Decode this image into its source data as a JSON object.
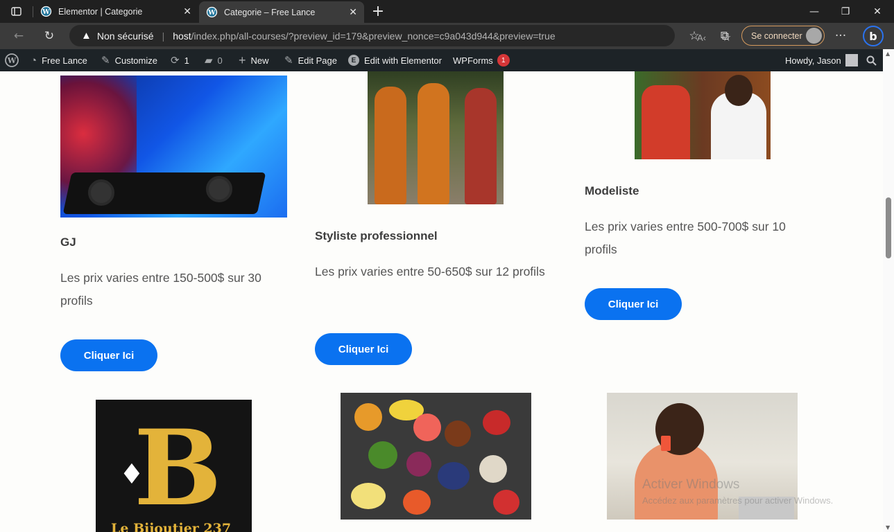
{
  "browser": {
    "tabs": [
      {
        "title": "Elementor | Categorie",
        "active": false
      },
      {
        "title": "Categorie – Free Lance",
        "active": true
      }
    ],
    "new_tab": "+",
    "address": {
      "security_label": "Non sécurisé",
      "host": "host",
      "path": "/index.php/all-courses/?preview_id=179&preview_nonce=c9a043d944&preview=true"
    },
    "sign_in_label": "Se connecter"
  },
  "wp_admin_bar": {
    "site_name": "Free Lance",
    "customize": "Customize",
    "updates_count": "1",
    "comments_count": "0",
    "new": "New",
    "edit_page": "Edit Page",
    "edit_elementor": "Edit with Elementor",
    "wpforms": "WPForms",
    "wpforms_badge": "1",
    "howdy": "Howdy, Jason"
  },
  "cards": [
    {
      "title": "GJ",
      "description": "Les prix varies entre 150-500$ sur 30 profils",
      "button": "Cliquer Ici"
    },
    {
      "title": "Styliste professionnel",
      "description": "Les prix varies entre 50-650$ sur 12 profils",
      "button": "Cliquer Ici"
    },
    {
      "title": "Modeliste",
      "description": "Les prix varies entre 500-700$ sur 10 profils",
      "button": "Cliquer Ici"
    }
  ],
  "bottom_images": {
    "bijou_text": "Le Bijoutier 237"
  },
  "watermark": {
    "line1": "Activer Windows",
    "line2": "Accédez aux paramètres pour activer Windows."
  },
  "colors": {
    "accent": "#0a72f0",
    "wp_bar": "#1d2327",
    "badge": "#d63638"
  }
}
